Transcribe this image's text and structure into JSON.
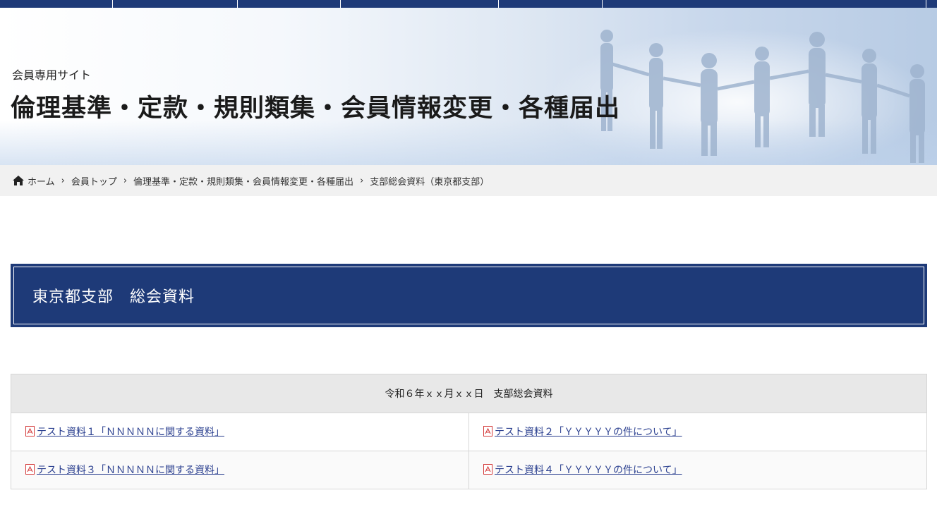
{
  "hero": {
    "subtitle": "会員専用サイト",
    "title": "倫理基準・定款・規則類集・会員情報変更・各種届出"
  },
  "breadcrumb": {
    "items": [
      "ホーム",
      "会員トップ",
      "倫理基準・定款・規則類集・会員情報変更・各種届出",
      "支部総会資料（東京都支部）"
    ]
  },
  "section": {
    "heading": "東京都支部　総会資料"
  },
  "documents": {
    "header": "令和６年ｘｘ月ｘｘ日　支部総会資料",
    "links": [
      "テスト資料１「ＮＮＮＮＮに関する資料」",
      "テスト資料２「ＹＹＹＹＹの件について」",
      "テスト資料３「ＮＮＮＮＮに関する資料」",
      "テスト資料４「ＹＹＹＹＹの件について」"
    ]
  },
  "colors": {
    "navy": "#1e3a78",
    "link": "#2a3f8f",
    "pdf_red": "#d43a3a"
  }
}
